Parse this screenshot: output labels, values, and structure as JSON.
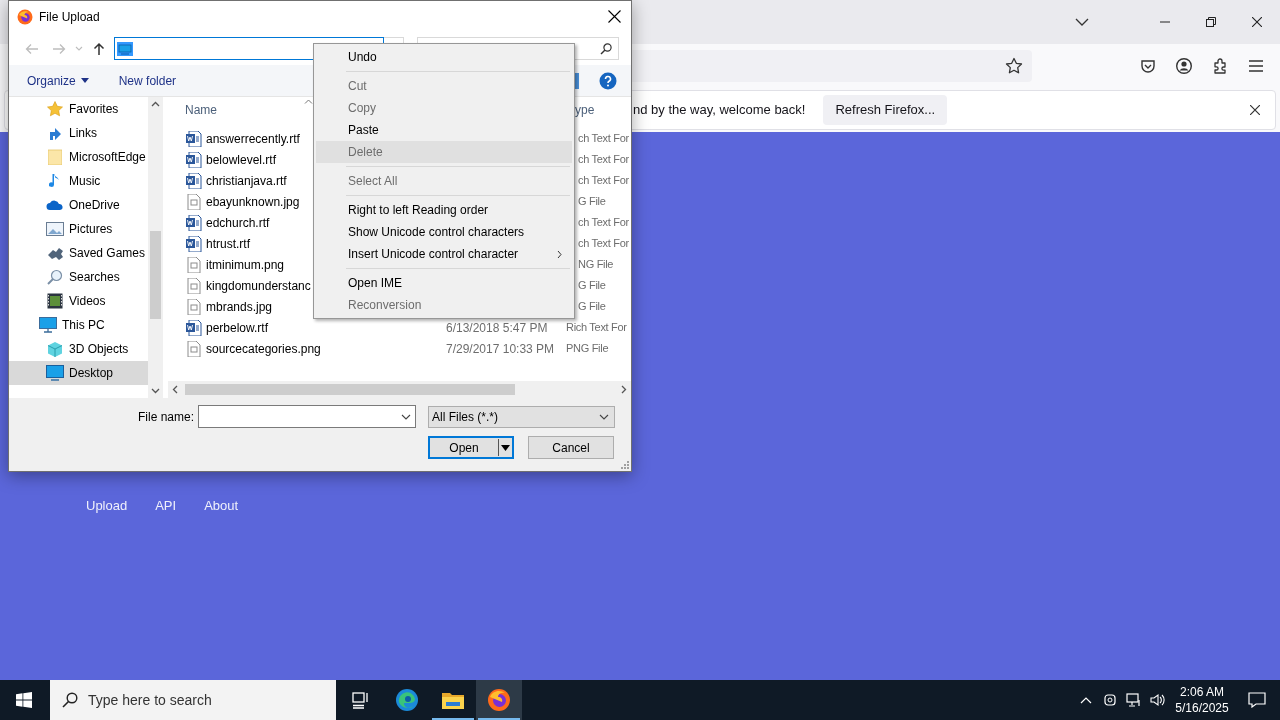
{
  "browser": {
    "notification": {
      "message": "nd by the way, welcome back!",
      "button": "Refresh Firefox..."
    },
    "footer_links": [
      "Upload",
      "API",
      "About"
    ]
  },
  "dialog": {
    "title": "File Upload",
    "commands": [
      "Organize",
      "New folder"
    ],
    "nav": [
      {
        "label": "Favorites",
        "selected": false
      },
      {
        "label": "Links",
        "selected": false
      },
      {
        "label": "MicrosoftEdge",
        "selected": false
      },
      {
        "label": "Music",
        "selected": false
      },
      {
        "label": "OneDrive",
        "selected": false
      },
      {
        "label": "Pictures",
        "selected": false
      },
      {
        "label": "Saved Games",
        "selected": false
      },
      {
        "label": "Searches",
        "selected": false
      },
      {
        "label": "Videos",
        "selected": false
      },
      {
        "label": "This PC",
        "selected": false,
        "children": [
          {
            "label": "3D Objects",
            "selected": false
          },
          {
            "label": "Desktop",
            "selected": true
          }
        ]
      }
    ],
    "columns": [
      "Name",
      "ype"
    ],
    "files": [
      {
        "name": "answerrecently.rtf",
        "kind": "document",
        "type": "ch Text For"
      },
      {
        "name": "belowlevel.rtf",
        "kind": "document",
        "type": "ch Text For"
      },
      {
        "name": "christianjava.rtf",
        "kind": "document",
        "type": "ch Text For"
      },
      {
        "name": "ebayunknown.jpg",
        "kind": "image",
        "type": "G File"
      },
      {
        "name": "edchurch.rtf",
        "kind": "document",
        "type": "ch Text For"
      },
      {
        "name": "htrust.rtf",
        "kind": "document",
        "type": "ch Text For"
      },
      {
        "name": "itminimum.png",
        "kind": "image",
        "type": "NG File"
      },
      {
        "name": "kingdomunderstanc",
        "kind": "image",
        "type": "G File"
      },
      {
        "name": "mbrands.jpg",
        "kind": "image",
        "type": "G File"
      },
      {
        "name": "perbelow.rtf",
        "kind": "document",
        "date": "6/13/2018 5:47 PM",
        "type": "Rich Text For"
      },
      {
        "name": "sourcecategories.png",
        "kind": "image",
        "date": "7/29/2017 10:33 PM",
        "type": "PNG File"
      }
    ],
    "file_name_label": "File name:",
    "filter": "All Files (*.*)",
    "buttons": [
      "Open",
      "Cancel"
    ]
  },
  "context_menu": [
    {
      "kind": "item",
      "label": "Undo",
      "disabled": false,
      "selected": false,
      "submenu": false
    },
    {
      "kind": "separator"
    },
    {
      "kind": "item",
      "label": "Cut",
      "disabled": true,
      "selected": false,
      "submenu": false
    },
    {
      "kind": "item",
      "label": "Copy",
      "disabled": true,
      "selected": false,
      "submenu": false
    },
    {
      "kind": "item",
      "label": "Paste",
      "disabled": false,
      "selected": false,
      "submenu": false
    },
    {
      "kind": "item",
      "label": "Delete",
      "disabled": true,
      "selected": true,
      "submenu": false
    },
    {
      "kind": "separator"
    },
    {
      "kind": "item",
      "label": "Select All",
      "disabled": true,
      "selected": false,
      "submenu": false
    },
    {
      "kind": "separator"
    },
    {
      "kind": "item",
      "label": "Right to left Reading order",
      "disabled": false,
      "selected": false,
      "submenu": false
    },
    {
      "kind": "item",
      "label": "Show Unicode control characters",
      "disabled": false,
      "selected": false,
      "submenu": false
    },
    {
      "kind": "item",
      "label": "Insert Unicode control character",
      "disabled": false,
      "selected": false,
      "submenu": true
    },
    {
      "kind": "separator"
    },
    {
      "kind": "item",
      "label": "Open IME",
      "disabled": false,
      "selected": false,
      "submenu": false
    },
    {
      "kind": "item",
      "label": "Reconversion",
      "disabled": true,
      "selected": false,
      "submenu": false
    }
  ],
  "taskbar": {
    "search_placeholder": "Type here to search",
    "apps": [
      {
        "open": false,
        "selected": false
      },
      {
        "open": false,
        "selected": false
      },
      {
        "open": true,
        "selected": false
      },
      {
        "open": true,
        "selected": true
      }
    ],
    "time": "2:06 AM",
    "date": "5/16/2025"
  }
}
